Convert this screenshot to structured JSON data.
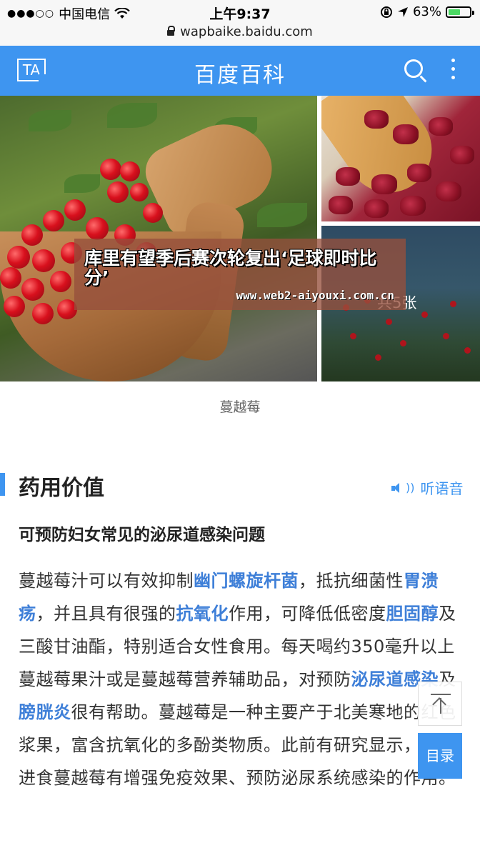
{
  "status_bar": {
    "signal_dots": "●●●○○",
    "carrier": "中国电信",
    "time": "上午9:37",
    "battery_percent": "63%",
    "battery_level": 0.63
  },
  "browser": {
    "url": "wapbaike.baidu.com"
  },
  "header": {
    "ta_label": "TA",
    "title": "百度百科"
  },
  "gallery": {
    "photo_count": "共5张",
    "caption": "蔓越莓"
  },
  "overlay": {
    "title": "库里有望季后赛次轮复出‘足球即时比分’",
    "url": "www.web2-aiyouxi.com.cn"
  },
  "section": {
    "title": "药用价值",
    "listen_label": "听语音",
    "subtitle": "可预防妇女常见的泌尿道感染问题"
  },
  "paragraph": {
    "t1": "蔓越莓汁可以有效抑制",
    "link1": "幽门螺旋杆菌",
    "t2": "，抵抗细菌性",
    "link2": "胃溃疡",
    "t3": "，并且具有很强的",
    "link3": "抗氧化",
    "t4": "作用，可降低低密度",
    "link4": "胆固醇",
    "t5": "及三酸甘油酯，特别适合女性食用。每天喝约350毫升以上蔓越莓果汁或是蔓越莓营养辅助品，对预防",
    "link5": "泌尿道感染",
    "t6": "及",
    "link6": "膀胱炎",
    "t7": "很有帮助。蔓越莓是一种主要产于北美寒地的红色浆果，富含抗氧化的多酚类物质。此前有研究显示，适当进食蔓越莓有增强免疫效果、预防泌尿系统感染的作用。"
  },
  "floating": {
    "toc_label": "目录"
  },
  "colors": {
    "accent": "#3e95f0",
    "link": "#3e7fd8"
  }
}
